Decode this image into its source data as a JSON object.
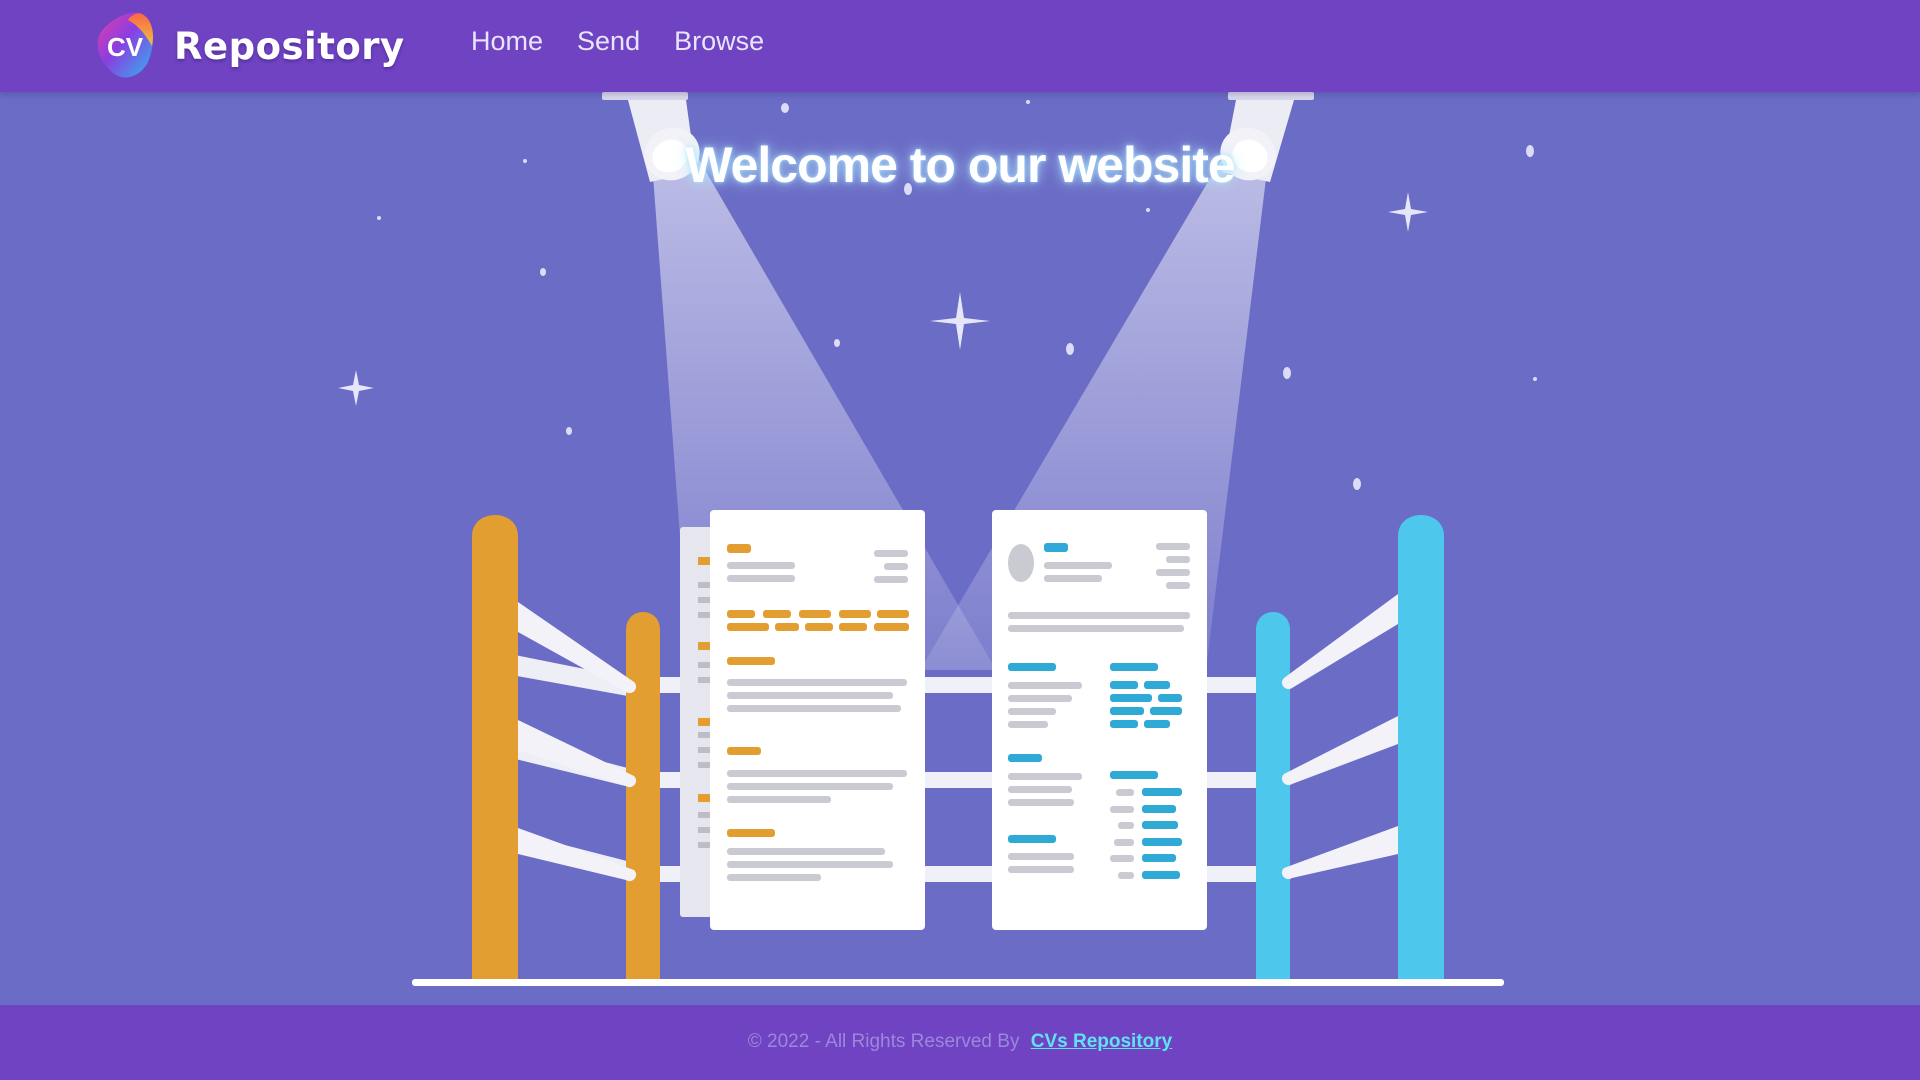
{
  "header": {
    "logo_text": "CV",
    "brand": "Repository",
    "nav": [
      {
        "label": "Home"
      },
      {
        "label": "Send"
      },
      {
        "label": "Browse"
      }
    ]
  },
  "hero": {
    "title": "Welcome to our website"
  },
  "footer": {
    "copyright": "© 2022 - All Rights Reserved By",
    "link_label": "CVs Repository"
  },
  "colors": {
    "header_bg": "#6f43c2",
    "hero_bg": "#6b6cc6",
    "orange_post": "#e29e31",
    "blue_post": "#4dc8ec",
    "footer_link": "#5fe3f2"
  }
}
